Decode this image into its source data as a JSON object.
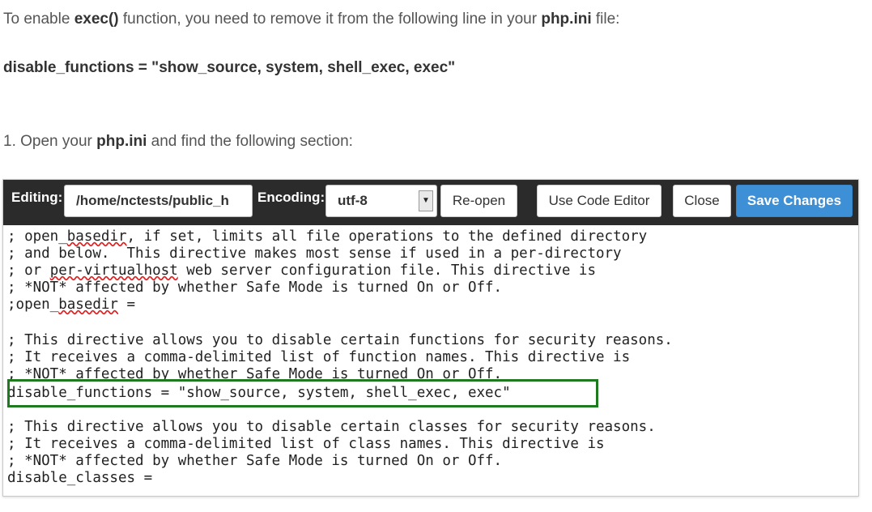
{
  "intro": {
    "part1": "To enable ",
    "bold1": "exec()",
    "part2": " function, you need to remove it from the following line in your ",
    "bold2": "php.ini",
    "part3": " file:"
  },
  "code_snippet": "disable_functions = \"show_source, system, shell_exec, exec\"",
  "step1": {
    "part1": "1. Open your ",
    "bold": "php.ini",
    "part2": " and find the following section:"
  },
  "toolbar": {
    "editing_label": "Editing:",
    "path_value": "/home/nctests/public_h",
    "encoding_label": "Encoding:",
    "encoding_value": "utf-8",
    "reopen_label": "Re-open",
    "code_editor_label": "Use Code Editor",
    "close_label": "Close",
    "save_label": "Save Changes",
    "dropdown_icon": "caret-down-icon"
  },
  "editor_lines": [
    "; open_basedir, if set, limits all file operations to the defined directory",
    "; and below.  This directive makes most sense if used in a per-directory",
    "; or per-virtualhost web server configuration file. This directive is",
    "; *NOT* affected by whether Safe Mode is turned On or Off.",
    ";open_basedir =",
    "",
    "; This directive allows you to disable certain functions for security reasons.",
    "; It receives a comma-delimited list of function names. This directive is",
    "; *NOT* affected by whether Safe Mode is turned On or Off.",
    "disable_functions = \"show_source, system, shell_exec, exec\"",
    "",
    "; This directive allows you to disable certain classes for security reasons.",
    "; It receives a comma-delimited list of class names. This directive is",
    "; *NOT* affected by whether Safe Mode is turned On or Off.",
    "disable_classes ="
  ],
  "colors": {
    "toolbar_bg": "#2b2b2b",
    "save_button": "#3d8fd6",
    "highlight_border": "#1f7a1f"
  }
}
